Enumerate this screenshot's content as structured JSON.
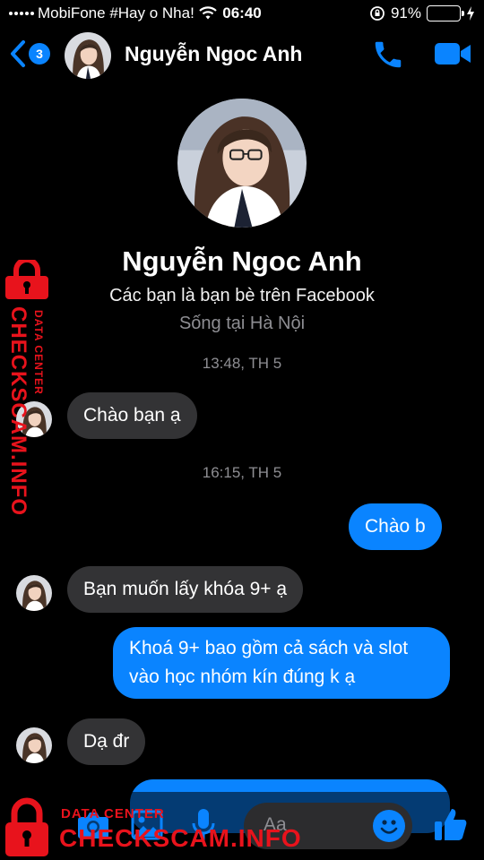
{
  "status_bar": {
    "carrier": "MobiFone #Hay o Nha!",
    "time": "06:40",
    "battery_percent": "91%",
    "battery_level": 0.91
  },
  "header": {
    "back_badge_count": "3",
    "contact_name": "Nguyễn Ngoc Anh"
  },
  "profile": {
    "name": "Nguyễn Ngoc Anh",
    "relationship": "Các bạn là bạn bè trên Facebook",
    "location": "Sống tại Hà Nội"
  },
  "messages": [
    {
      "type": "timestamp",
      "text": "13:48, TH 5"
    },
    {
      "type": "incoming",
      "text": "Chào bạn ạ"
    },
    {
      "type": "timestamp",
      "text": "16:15, TH 5"
    },
    {
      "type": "outgoing",
      "text": "Chào b"
    },
    {
      "type": "incoming",
      "text": "Bạn muốn lấy khóa 9+ ạ"
    },
    {
      "type": "outgoing",
      "text": "Khoá 9+ bao gồm cả sách và slot vào học nhóm kín đúng k ạ"
    },
    {
      "type": "incoming",
      "text": "Dạ đr"
    }
  ],
  "composer": {
    "placeholder": "Aa"
  },
  "watermark": {
    "site": "CHECKSCAM.INFO",
    "tagline": "DATA CENTER"
  },
  "colors": {
    "accent": "#0a84ff",
    "incoming_bubble": "#333335",
    "watermark": "#e8131c"
  }
}
